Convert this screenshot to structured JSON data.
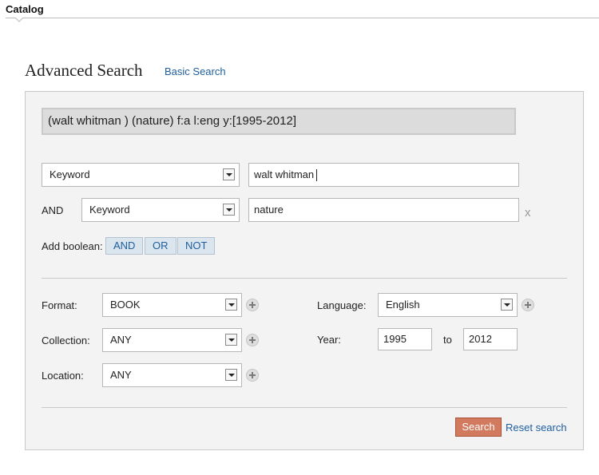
{
  "tab": {
    "label": "Catalog"
  },
  "title": "Advanced Search",
  "basic_search_link": "Basic Search",
  "query_string": "(walt whitman ) (nature) f:a l:eng y:[1995-2012]",
  "rows": [
    {
      "field": "Keyword",
      "value": "walt whitman"
    },
    {
      "operator": "AND",
      "field": "Keyword",
      "value": "nature",
      "remove": "x"
    }
  ],
  "add_boolean": {
    "label": "Add boolean:",
    "buttons": [
      "AND",
      "OR",
      "NOT"
    ]
  },
  "filters": {
    "format": {
      "label": "Format:",
      "value": "BOOK"
    },
    "collection": {
      "label": "Collection:",
      "value": "ANY"
    },
    "location": {
      "label": "Location:",
      "value": "ANY"
    },
    "language": {
      "label": "Language:",
      "value": "English"
    },
    "year": {
      "label": "Year:",
      "from": "1995",
      "to_label": "to",
      "to": "2012"
    }
  },
  "actions": {
    "search": "Search",
    "reset": "Reset search"
  },
  "colors": {
    "link": "#1f5fa0",
    "search_button": "#d27a5e",
    "panel_bg": "#f3f3f3"
  }
}
